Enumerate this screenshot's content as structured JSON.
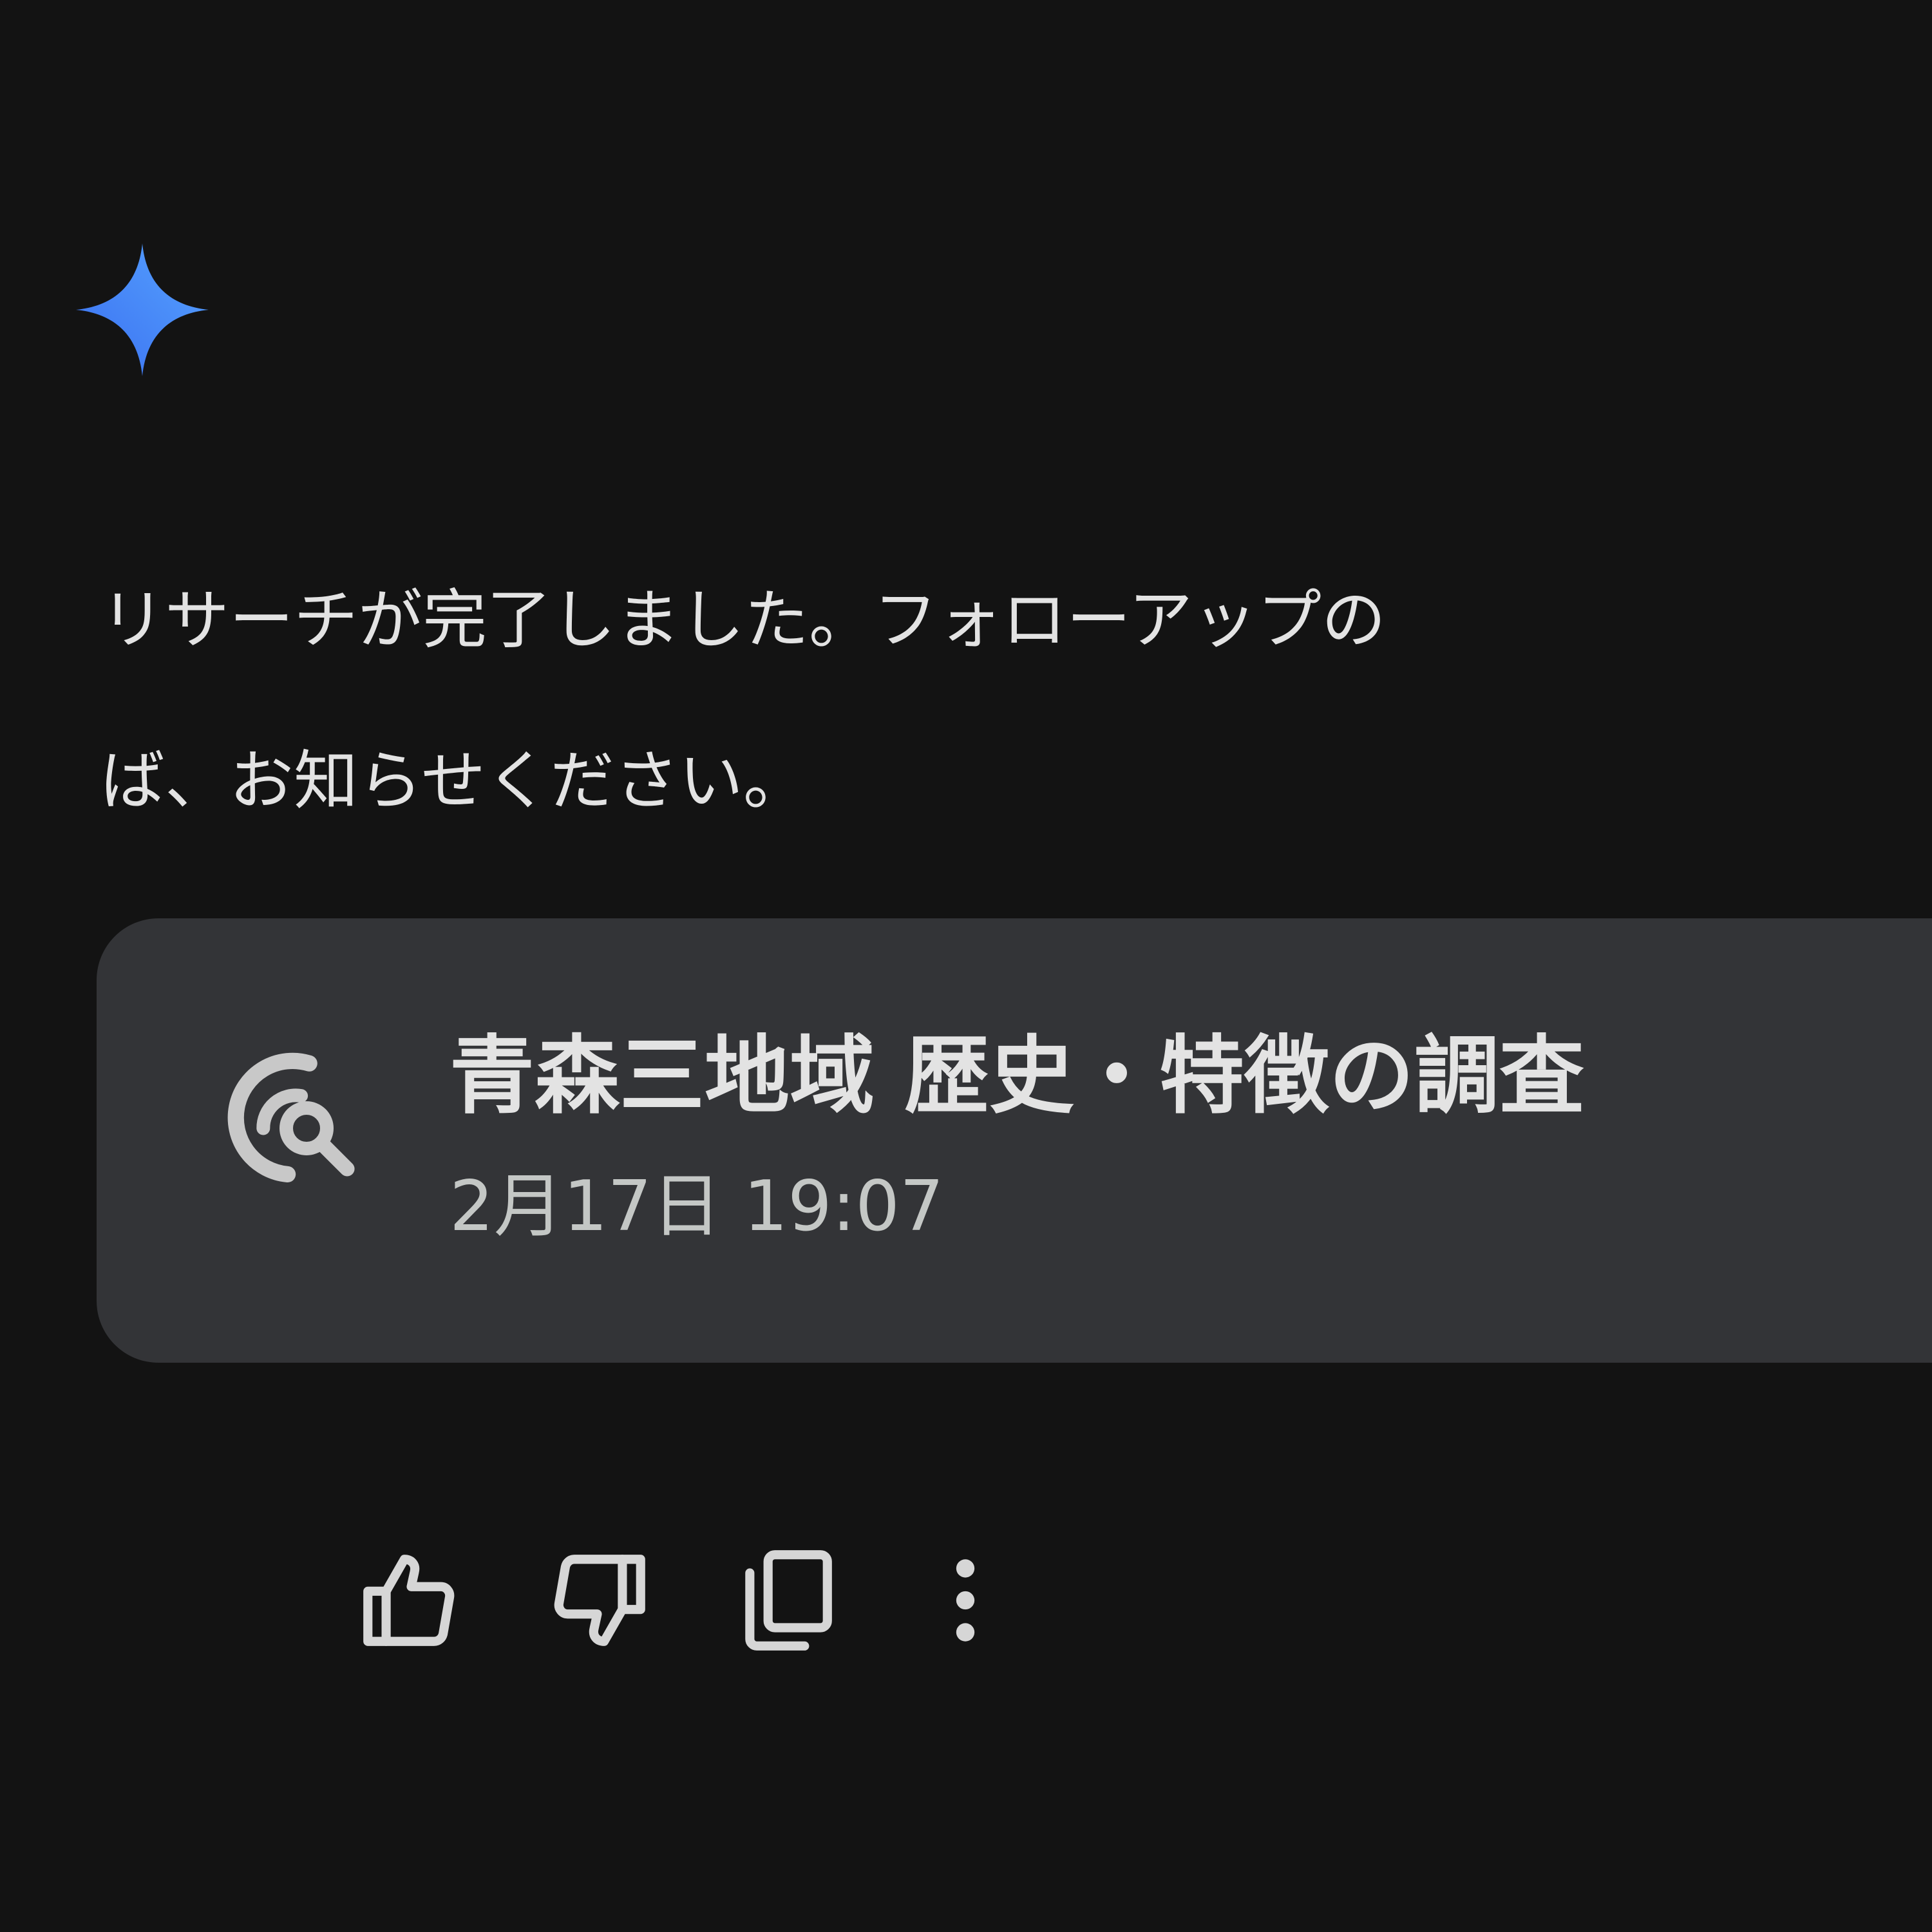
{
  "response": {
    "message_lines": [
      "リサーチが完了しました。フォローアップの",
      "ば、お知らせください。"
    ]
  },
  "research_card": {
    "title": "青森三地域 歴史・特徴の調査",
    "date": "2月17日 19:07",
    "icon": "research-search-icon"
  },
  "actions": [
    {
      "icon": "thumbs-up-icon"
    },
    {
      "icon": "thumbs-down-icon"
    },
    {
      "icon": "copy-icon"
    },
    {
      "icon": "more-vert-icon"
    }
  ],
  "colors": {
    "background": "#131313",
    "card": "#333437",
    "text": "#e3e3e3",
    "sparkle": "#4b8ff7"
  }
}
